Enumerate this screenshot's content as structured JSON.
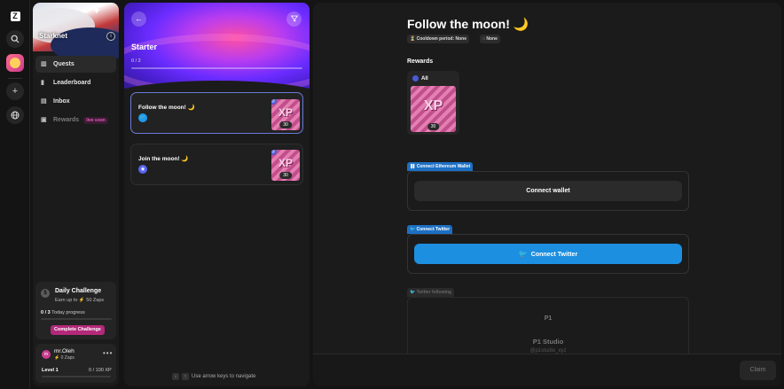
{
  "rail": {
    "logo": "Z",
    "search_icon": "search-icon",
    "plus": "+",
    "globe": "globe-icon"
  },
  "sidebar": {
    "network": "Starknet",
    "items": [
      {
        "label": "Quests",
        "icon": "grid-icon"
      },
      {
        "label": "Leaderboard",
        "icon": "bar-chart-icon"
      },
      {
        "label": "Inbox",
        "icon": "inbox-icon"
      },
      {
        "label": "Rewards",
        "icon": "gift-icon",
        "badge": "live soon"
      }
    ],
    "daily": {
      "icon": "$",
      "title": "Daily Challenge",
      "subtitle": "Earn up to ⚡ 50 Zaps",
      "progress_value": "0 / 3",
      "progress_label": "Today progress",
      "button": "Complete Challenge"
    },
    "user": {
      "avatar": "m",
      "name": "mr.Oleh",
      "zaps": "⚡ 0 Zaps",
      "menu": "•••",
      "level": "Level 1",
      "xp": "0 / 100 XP"
    }
  },
  "quests": {
    "title": "Starter",
    "progress": "0 / 2",
    "items": [
      {
        "title": "Follow the moon! 🌙",
        "platform": "twitter",
        "xp_label": "XP",
        "xp": "30"
      },
      {
        "title": "Join the moon! 🌙",
        "platform": "discord",
        "xp_label": "XP",
        "xp": "30"
      }
    ],
    "nav_hint": "Use arrow keys to navigate",
    "key_down": "↓",
    "key_up": "↑"
  },
  "detail": {
    "title": "Follow the moon! 🌙",
    "pills": [
      "⏳ Cooldown period: None",
      "◌ None"
    ],
    "rewards_label": "Rewards",
    "reward_all": "All",
    "reward_xp_label": "XP",
    "reward_xp": "30",
    "eth_tag": "⛓ Connect Ethereum Wallet",
    "eth_button": "Connect wallet",
    "tw_tag": "🐦 Connect Twitter",
    "tw_button": "Connect Twitter",
    "follow_tag": "🐦 Twitter following",
    "follow_logo": "P1",
    "follow_name": "P1 Studio",
    "follow_handle": "@p1studio_xyz",
    "claim": "Claim"
  },
  "colors": {
    "accent": "#1d8fe0",
    "brand": "#b3297a",
    "banner": "#6a2cff"
  }
}
